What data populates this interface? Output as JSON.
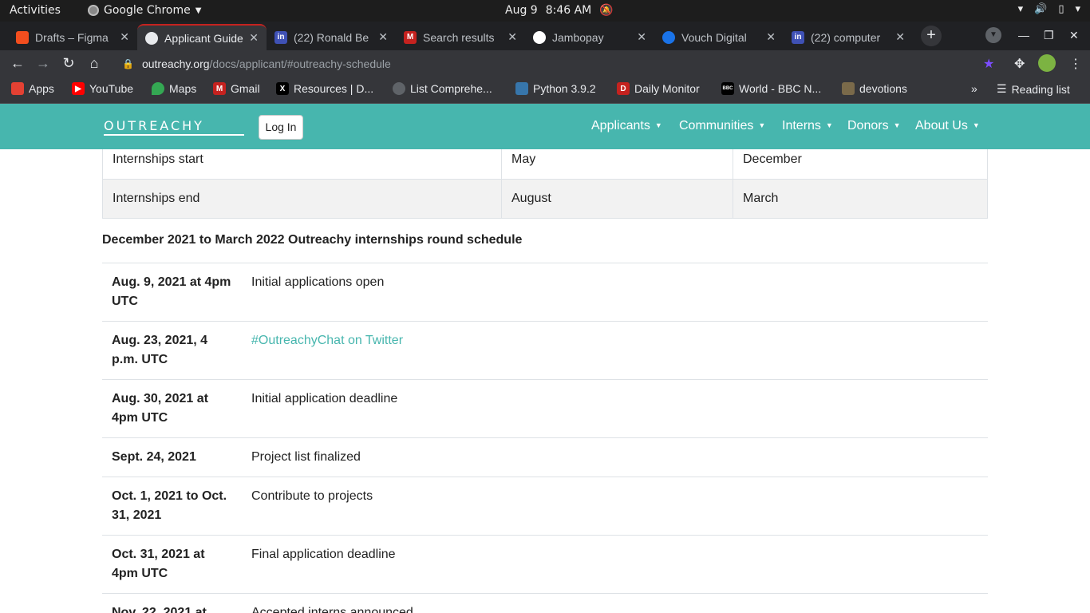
{
  "topbar": {
    "activities": "Activities",
    "app_name": "Google Chrome",
    "date": "Aug 9",
    "time": "8:46 AM"
  },
  "tabs": [
    {
      "title": "Drafts – Figma",
      "color": "#f24e1e",
      "letter": "F"
    },
    {
      "title": "Applicant Guide",
      "color": "#e8eaed",
      "letter": ""
    },
    {
      "title": "(22) Ronald Be",
      "color": "#3f51b5",
      "letter": "in"
    },
    {
      "title": "Search results",
      "color": "#c5221f",
      "letter": "M"
    },
    {
      "title": "Jambopay",
      "color": "#ffffff",
      "letter": ""
    },
    {
      "title": "Vouch Digital",
      "color": "#1a73e8",
      "letter": ""
    },
    {
      "title": "(22) computer",
      "color": "#3f51b5",
      "letter": "in"
    }
  ],
  "omnibox": {
    "host": "outreachy.org",
    "path": "/docs/applicant/#outreachy-schedule"
  },
  "bookmarks": [
    {
      "label": "Apps",
      "color": "#e34133",
      "letter": ""
    },
    {
      "label": "YouTube",
      "color": "#ff0000",
      "letter": "▶"
    },
    {
      "label": "Maps",
      "color": "#34a853",
      "letter": ""
    },
    {
      "label": "Gmail",
      "color": "#c5221f",
      "letter": "M"
    },
    {
      "label": "Resources | D...",
      "color": "#000000",
      "letter": "X"
    },
    {
      "label": "List Comprehe...",
      "color": "#5f6368",
      "letter": ""
    },
    {
      "label": "Python 3.9.2",
      "color": "#3776ab",
      "letter": ""
    },
    {
      "label": "Daily Monitor",
      "color": "#c5221f",
      "letter": "D"
    },
    {
      "label": "World - BBC N...",
      "color": "#000000",
      "letter": "BBC"
    },
    {
      "label": "devotions",
      "color": "#7a6a4a",
      "letter": ""
    }
  ],
  "reading_list": "Reading list",
  "site": {
    "logo": "OUTREACHY",
    "login": "Log In",
    "nav": [
      "Applicants",
      "Communities",
      "Interns",
      "Donors",
      "About Us"
    ]
  },
  "summary_table": [
    {
      "label": "Internships start",
      "may": "May",
      "dec": "December"
    },
    {
      "label": "Internships end",
      "may": "August",
      "dec": "March"
    }
  ],
  "schedule_heading": "December 2021 to March 2022 Outreachy internships round schedule",
  "schedule": [
    {
      "date": "Aug. 9, 2021 at 4pm UTC",
      "event": "Initial applications open",
      "link": false
    },
    {
      "date": "Aug. 23, 2021, 4 p.m. UTC",
      "event": "#OutreachyChat on Twitter",
      "link": true
    },
    {
      "date": "Aug. 30, 2021 at 4pm UTC",
      "event": "Initial application deadline",
      "link": false
    },
    {
      "date": "Sept. 24, 2021",
      "event": "Project list finalized",
      "link": false
    },
    {
      "date": "Oct. 1, 2021 to Oct. 31, 2021",
      "event": "Contribute to projects",
      "link": false
    },
    {
      "date": "Oct. 31, 2021 at 4pm UTC",
      "event": "Final application deadline",
      "link": false
    },
    {
      "date": "Nov. 22, 2021 at",
      "event": "Accepted interns announced",
      "link": false
    }
  ]
}
